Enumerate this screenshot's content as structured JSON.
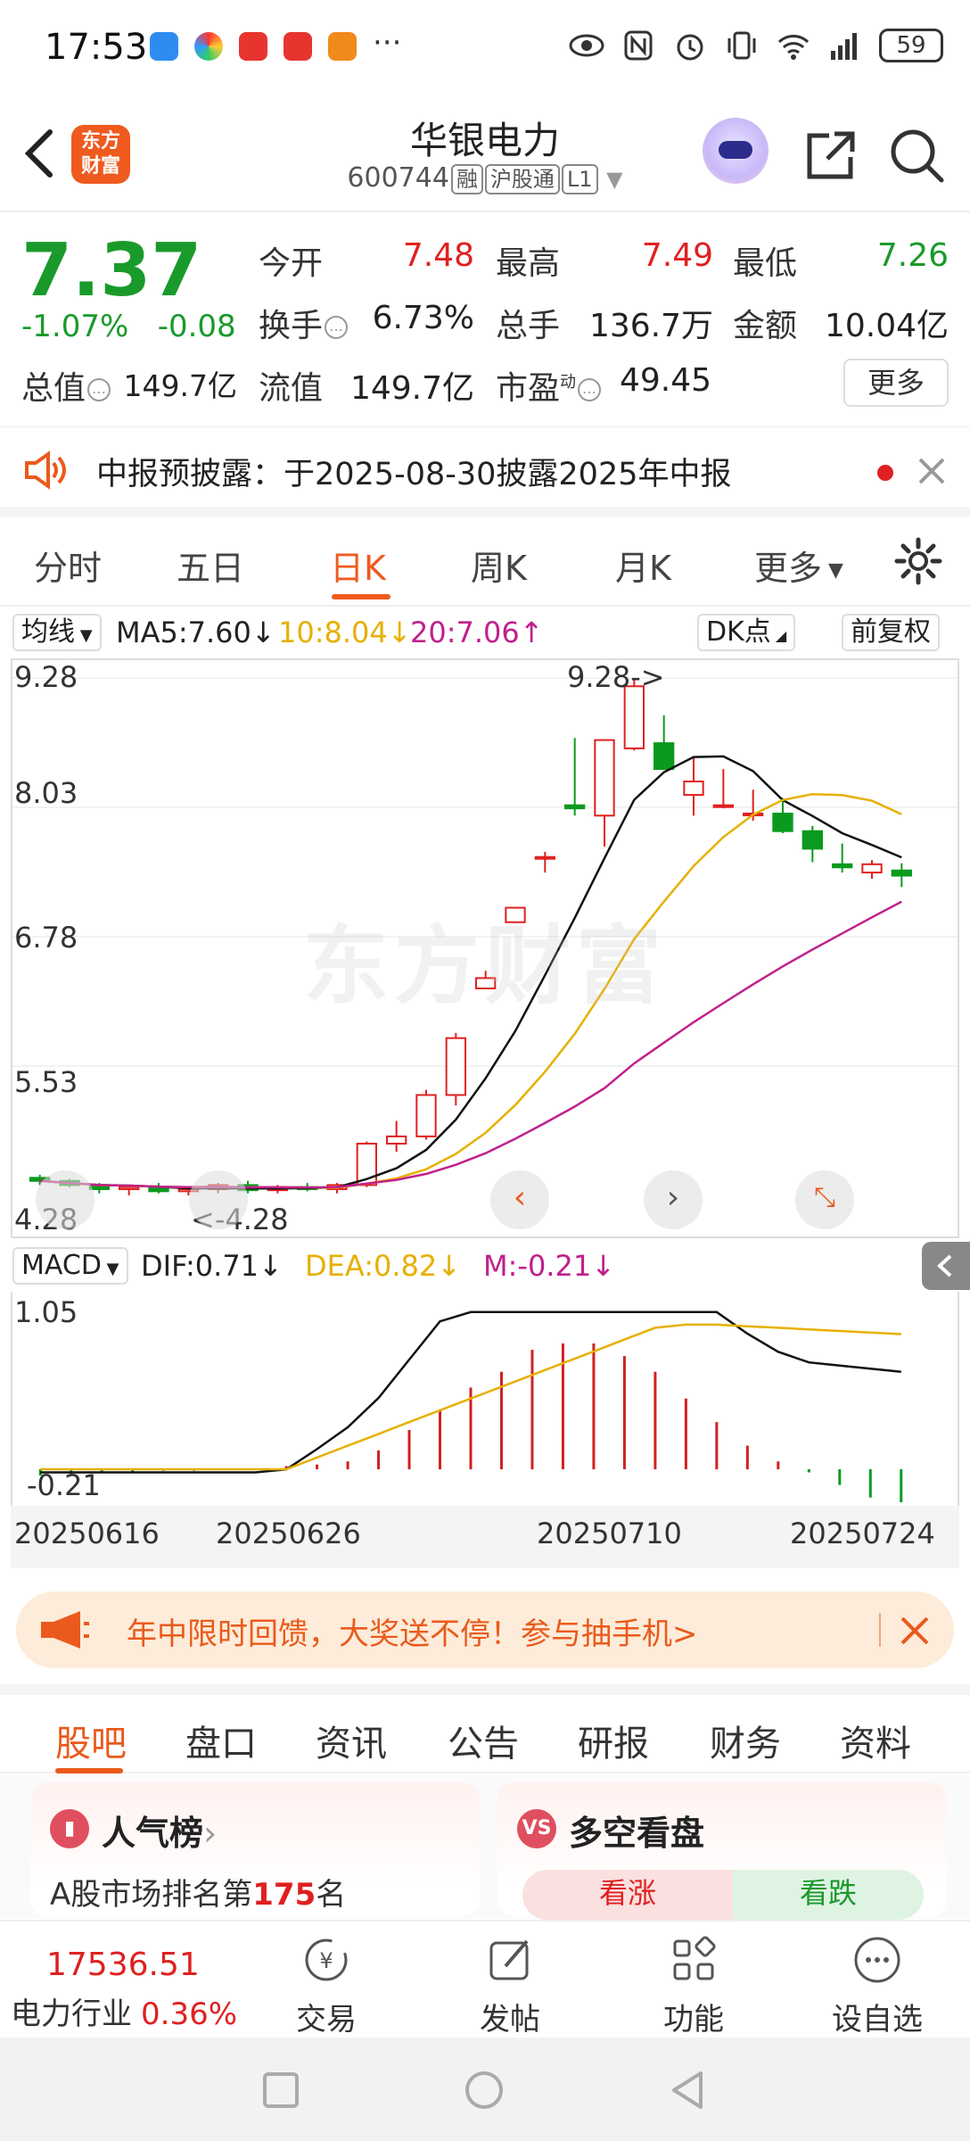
{
  "status_bar": {
    "time": "17:53",
    "battery": "59",
    "dots": "···"
  },
  "header": {
    "back_label": "",
    "logo_text": "东方\n财富",
    "title": "华银电力",
    "code": "600744",
    "tags": [
      "融",
      "沪股通",
      "L1"
    ]
  },
  "quote": {
    "price": "7.37",
    "change_pct": "-1.07%",
    "change": "-0.08",
    "items": [
      {
        "label": "今开",
        "value": "7.48"
      },
      {
        "label": "最高",
        "value": "7.49"
      },
      {
        "label": "最低",
        "value": "7.26"
      },
      {
        "label": "换手",
        "value": "6.73%"
      },
      {
        "label": "总手",
        "value": "136.7万"
      },
      {
        "label": "金额",
        "value": "10.04亿"
      },
      {
        "label": "总值",
        "value": "149.7亿"
      },
      {
        "label": "流值",
        "value": "149.7亿"
      },
      {
        "label": "市盈",
        "value": "49.45"
      }
    ],
    "pe_sup": "动",
    "more_label": "更多"
  },
  "announcement": {
    "text": "中报预披露：于2025-08-30披露2025年中报"
  },
  "period_tabs": [
    "分时",
    "五日",
    "日K",
    "周K",
    "月K",
    "更多"
  ],
  "ma_bar": {
    "selector": "均线",
    "ma5": "MA5:7.60",
    "ma10": "10:8.04",
    "ma20": "20:7.06",
    "dk_label": "DK点",
    "adjust_label": "前复权",
    "arrow_down": "↓",
    "arrow_up": "↑"
  },
  "kchart": {
    "y_labels": [
      "9.28",
      "8.03",
      "6.78",
      "5.53",
      "4.28"
    ],
    "high_marker": "9.28->",
    "low_marker": "<-4.28",
    "watermark": "东方财富"
  },
  "macd_bar": {
    "selector": "MACD",
    "dif": "DIF:0.71",
    "dea": "DEA:0.82",
    "m": "M:-0.21",
    "arrow": "↓"
  },
  "macd_chart": {
    "y_labels": [
      "1.05",
      "-0.21"
    ]
  },
  "dates": [
    "20250616",
    "20250626",
    "20250710",
    "20250724"
  ],
  "chart_data": [
    {
      "type": "candlestick",
      "title": "",
      "x": [
        "20250613",
        "20250616",
        "20250617",
        "20250618",
        "20250619",
        "20250620",
        "20250623",
        "20250624",
        "20250625",
        "20250626",
        "20250627",
        "20250630",
        "20250701",
        "20250702",
        "20250703",
        "20250704",
        "20250707",
        "20250708",
        "20250709",
        "20250710",
        "20250711",
        "20250714",
        "20250715",
        "20250716",
        "20250717",
        "20250718",
        "20250721",
        "20250722",
        "20250723",
        "20250724",
        "20250725"
      ],
      "ohlc": [
        [
          4.45,
          4.48,
          4.38,
          4.42
        ],
        [
          4.42,
          4.44,
          4.36,
          4.38
        ],
        [
          4.38,
          4.4,
          4.3,
          4.34
        ],
        [
          4.34,
          4.38,
          4.28,
          4.36
        ],
        [
          4.36,
          4.4,
          4.3,
          4.32
        ],
        [
          4.32,
          4.36,
          4.28,
          4.34
        ],
        [
          4.34,
          4.4,
          4.3,
          4.38
        ],
        [
          4.38,
          4.42,
          4.3,
          4.33
        ],
        [
          4.33,
          4.38,
          4.3,
          4.36
        ],
        [
          4.36,
          4.4,
          4.32,
          4.34
        ],
        [
          4.34,
          4.4,
          4.3,
          4.38
        ],
        [
          4.38,
          4.8,
          4.36,
          4.78
        ],
        [
          4.78,
          5.0,
          4.7,
          4.85
        ],
        [
          4.85,
          5.3,
          4.82,
          5.25
        ],
        [
          5.25,
          5.85,
          5.15,
          5.8
        ],
        [
          6.28,
          6.45,
          6.28,
          6.38
        ],
        [
          6.92,
          7.06,
          6.92,
          7.06
        ],
        [
          7.55,
          7.6,
          7.4,
          7.55
        ],
        [
          8.05,
          8.7,
          7.95,
          8.02
        ],
        [
          7.95,
          8.6,
          7.65,
          8.68
        ],
        [
          8.6,
          9.28,
          8.58,
          9.2
        ],
        [
          8.65,
          8.92,
          8.5,
          8.4
        ],
        [
          8.15,
          8.52,
          7.95,
          8.28
        ],
        [
          8.05,
          8.4,
          8.02,
          8.05
        ],
        [
          7.97,
          8.2,
          7.9,
          7.97
        ],
        [
          7.97,
          8.12,
          7.78,
          7.8
        ],
        [
          7.8,
          7.85,
          7.5,
          7.63
        ],
        [
          7.48,
          7.68,
          7.4,
          7.45
        ],
        [
          7.4,
          7.52,
          7.34,
          7.48
        ],
        [
          7.42,
          7.49,
          7.26,
          7.37
        ]
      ],
      "ma": [
        {
          "name": "MA5",
          "last": 7.6
        },
        {
          "name": "MA10",
          "last": 8.04
        },
        {
          "name": "MA20",
          "last": 7.06
        }
      ],
      "ylim": [
        4.28,
        9.28
      ],
      "grid": true
    },
    {
      "type": "bar",
      "title": "MACD",
      "values": [
        -0.04,
        -0.03,
        -0.02,
        -0.02,
        -0.01,
        -0.01,
        0,
        0,
        0.02,
        0.03,
        0.05,
        0.12,
        0.25,
        0.38,
        0.52,
        0.62,
        0.76,
        0.8,
        0.8,
        0.72,
        0.62,
        0.45,
        0.3,
        0.15,
        0.05,
        -0.02,
        -0.1,
        -0.18,
        -0.21
      ],
      "dif_last": 0.71,
      "dea_last": 0.82,
      "ylim": [
        -0.21,
        1.05
      ]
    }
  ],
  "promo": {
    "text": "年中限时回馈，大奖送不停！参与抽手机>"
  },
  "section_tabs": [
    "股吧",
    "盘口",
    "资讯",
    "公告",
    "研报",
    "财务",
    "资料"
  ],
  "cards": {
    "left": {
      "title": "人气榜",
      "chevron": "›",
      "sub_prefix": "A股市场排名第",
      "rank": "175",
      "sub_suffix": "名"
    },
    "right": {
      "title": "多空看盘",
      "up": "看涨",
      "down": "看跌"
    }
  },
  "action_bar": {
    "index_value": "17536.51",
    "index_name": "电力行业",
    "index_change": "0.36%",
    "actions": [
      "交易",
      "发帖",
      "功能",
      "设自选"
    ]
  }
}
